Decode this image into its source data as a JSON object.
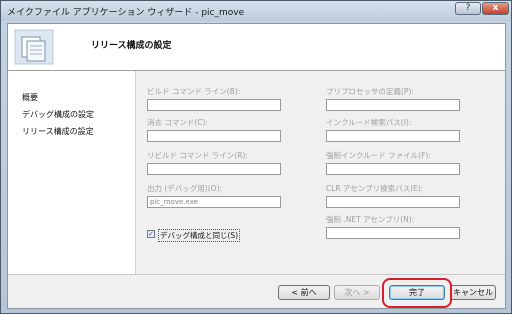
{
  "window": {
    "title": "メイクファイル アプリケーション ウィザード - pic_move",
    "help_button": "?",
    "close_button": "x"
  },
  "header": {
    "title": "リリース構成の設定",
    "icon": "wizard-page-icon"
  },
  "sidebar": {
    "items": [
      {
        "label": "概要"
      },
      {
        "label": "デバッグ構成の設定"
      },
      {
        "label": "リリース構成の設定"
      }
    ]
  },
  "form": {
    "build_command": {
      "label": "ビルド コマンド ライン(B):",
      "value": ""
    },
    "clean_command": {
      "label": "消去 コマンド(C):",
      "value": ""
    },
    "rebuild_command": {
      "label": "リビルド コマンド ライン(R):",
      "value": ""
    },
    "output": {
      "label": "出力 (デバッグ用)(O):",
      "value": "pic_move.exe"
    },
    "preprocessor": {
      "label": "プリプロセッサの定義(P):",
      "value": ""
    },
    "include_path": {
      "label": "インクルード検索パス(I):",
      "value": ""
    },
    "forced_include": {
      "label": "強制インクルード ファイル(F):",
      "value": ""
    },
    "clr_path": {
      "label": "CLR アセンブリ検索パス(E):",
      "value": ""
    },
    "forced_net": {
      "label": "強制 .NET アセンブリ(N):",
      "value": ""
    },
    "same_as_debug": {
      "label": "デバッグ構成と同じ(S)",
      "checked": true
    }
  },
  "buttons": {
    "back": "< 前へ",
    "next": "次へ >",
    "finish": "完了",
    "cancel": "キャンセル"
  },
  "colors": {
    "highlight": "#d4202a",
    "accent": "#3c7fb1"
  }
}
